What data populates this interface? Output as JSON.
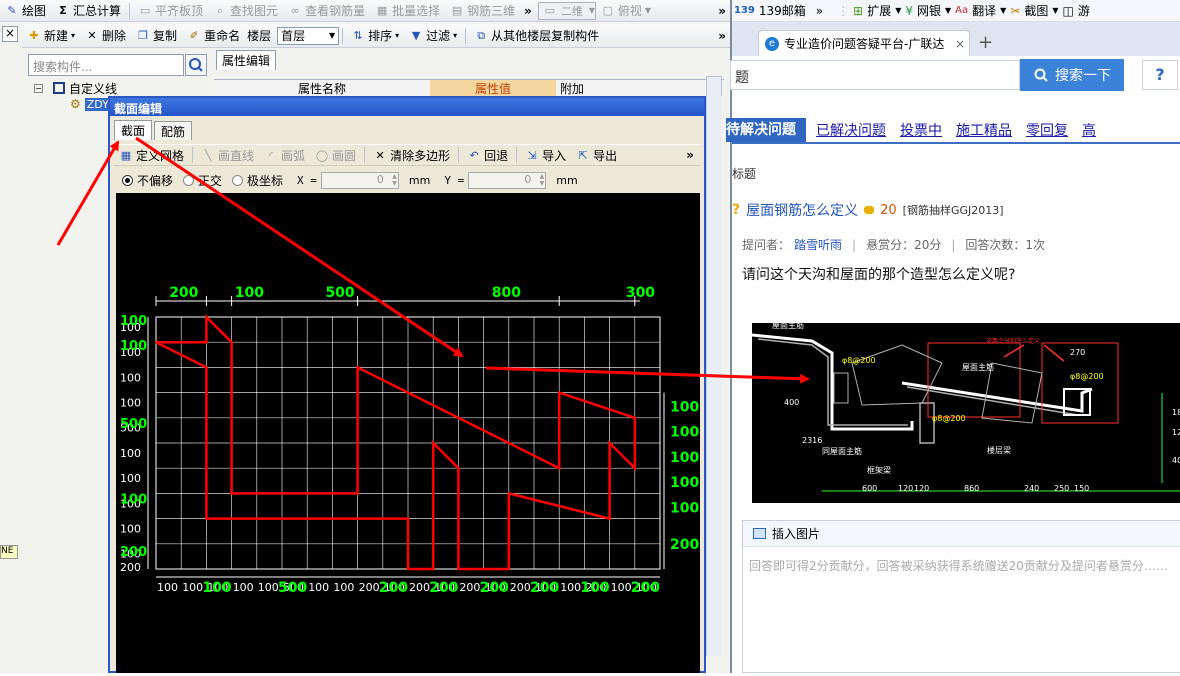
{
  "toolbar1": {
    "items": [
      {
        "label": "绘图",
        "icon": "draw-icon",
        "enabled": true
      },
      {
        "label": "汇总计算",
        "icon": "sigma-icon",
        "enabled": true
      },
      {
        "label": "平齐板顶",
        "icon": "align-icon",
        "enabled": false
      },
      {
        "label": "查找图元",
        "icon": "find-icon",
        "enabled": false
      },
      {
        "label": "查看钢筋量",
        "icon": "view-icon",
        "enabled": false
      },
      {
        "label": "批量选择",
        "icon": "batch-icon",
        "enabled": false
      },
      {
        "label": "钢筋三维",
        "icon": "3d-icon",
        "enabled": false
      }
    ],
    "more": "»",
    "view_mode": "二维",
    "view_angle": "俯视"
  },
  "toolbar2": {
    "items": [
      {
        "label": "新建",
        "icon": "new-icon"
      },
      {
        "label": "删除",
        "icon": "delete-icon"
      },
      {
        "label": "复制",
        "icon": "copy-icon"
      },
      {
        "label": "重命名",
        "icon": "rename-icon"
      }
    ],
    "floor_label": "楼层",
    "floor_value": "首层",
    "sort": "排序",
    "filter": "过滤",
    "copy_from": "从其他楼层复制构件",
    "more": "»"
  },
  "close_x": "×",
  "search": {
    "placeholder": "搜索构件..."
  },
  "tree": {
    "root": "自定义线",
    "child": "ZDY"
  },
  "props": {
    "tab": "属性编辑",
    "col_name": "属性名称",
    "col_value": "属性值",
    "col_extra": "附加"
  },
  "dialog": {
    "title": "截面编辑",
    "tabs": [
      "截面",
      "配筋"
    ],
    "tools": [
      {
        "label": "定义网格",
        "icon": "grid-icon",
        "enabled": true
      },
      {
        "label": "画直线",
        "icon": "line-icon",
        "enabled": false
      },
      {
        "label": "画弧",
        "icon": "arc-icon",
        "enabled": false
      },
      {
        "label": "画圆",
        "icon": "circle-icon",
        "enabled": false
      },
      {
        "label": "清除多边形",
        "icon": "clear-icon",
        "enabled": true
      },
      {
        "label": "回退",
        "icon": "undo-icon",
        "enabled": true
      },
      {
        "label": "导入",
        "icon": "import-icon",
        "enabled": true
      },
      {
        "label": "导出",
        "icon": "export-icon",
        "enabled": true
      }
    ],
    "more": "»",
    "offset_options": [
      "不偏移",
      "正交",
      "极坐标"
    ],
    "x_label": "X =",
    "x_value": "0",
    "x_unit": "mm",
    "y_label": "Y =",
    "y_value": "0",
    "y_unit": "mm"
  },
  "grid": {
    "top_dims": [
      "200",
      "100",
      "500",
      "800",
      "300"
    ],
    "left_dims": [
      "100",
      "100",
      "100",
      "100",
      "500",
      "100",
      "100",
      "100",
      "100",
      "100",
      "200"
    ],
    "left_dims_green": [
      "100",
      "100",
      "500",
      "100",
      "200"
    ],
    "right_dims": [
      "100",
      "100",
      "100",
      "100",
      "100",
      "200"
    ],
    "bottom_dims": [
      "100",
      "100",
      "100",
      "100",
      "100",
      "500",
      "100",
      "100",
      "200",
      "100",
      "200",
      "100",
      "200",
      "100",
      "200",
      "100",
      "100",
      "200",
      "100",
      "100"
    ],
    "bottom_dims_green": [
      "100",
      "500",
      "200",
      "200",
      "200",
      "200",
      "100",
      "200"
    ],
    "colors": {
      "grid": "#ffffff",
      "shape": "#ff0000",
      "dim_green": "#00ff00",
      "dim_white": "#ffffff",
      "background": "#000000"
    }
  },
  "browser": {
    "bookmarks": [
      {
        "label": "139邮箱",
        "icon": "mail-icon"
      },
      {
        "label": "扩展",
        "icon": "extension-icon"
      },
      {
        "label": "网银",
        "icon": "bank-icon"
      },
      {
        "label": "翻译",
        "icon": "translate-icon"
      },
      {
        "label": "截图",
        "icon": "scissors-icon"
      },
      {
        "label": "游",
        "icon": "game-icon"
      }
    ],
    "tab_title": "专业造价问题答疑平台-广联达",
    "tab_close": "×",
    "new_tab": "+",
    "search_text": "题",
    "search_button": "搜索一下",
    "help": "?",
    "nav_tabs": [
      "待解决问题",
      "已解决问题",
      "投票中",
      "施工精品",
      "零回复",
      "高"
    ],
    "section_title": "标题",
    "question_title": "屋面钢筋怎么定义",
    "coins": "20",
    "category": "[钢筋抽样GGJ2013]",
    "asker_label": "提问者：",
    "asker": "踏雪听雨",
    "reward": "悬赏分：20分",
    "answers": "回答次数：1次",
    "question_body": "请问这个天沟和屋面的那个造型怎么定义呢?",
    "insert_image": "插入图片",
    "answer_placeholder": "回答即可得2分贡献分，回答被采纳获得系统赠送20贡献分及提问者悬赏分……"
  },
  "drawing": {
    "labels": [
      "屋面主筋",
      "屋面主筋",
      "同屋面主筋",
      "框架梁",
      "楼层梁",
      "这两个分别怎么定义"
    ],
    "values": [
      "φ8@200",
      "φ8@200",
      "φ8@200",
      "270",
      "400",
      "2316",
      "600",
      "120",
      "120",
      "860",
      "240",
      "250",
      "150",
      "180",
      "120",
      "400"
    ]
  },
  "annotation": {
    "arrow_color": "#ff0000"
  }
}
